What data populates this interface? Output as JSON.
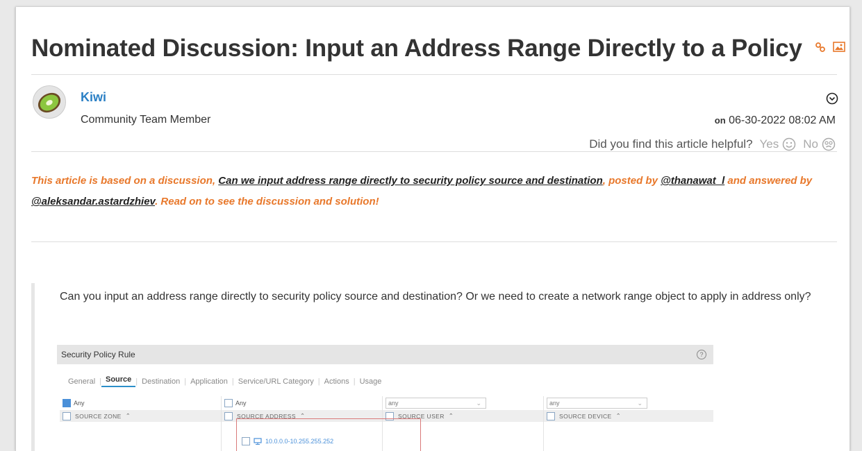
{
  "article": {
    "title": "Nominated Discussion: Input an Address Range Directly to a Policy",
    "title_icons": [
      "link-icon",
      "image-icon"
    ]
  },
  "author": {
    "name": "Kiwi",
    "role": "Community Team Member",
    "avatar": "kiwi-avatar"
  },
  "meta": {
    "date_prefix": "on",
    "date": "06-30-2022 08:02 AM",
    "helpful_question": "Did you find this article helpful?",
    "yes_label": "Yes",
    "no_label": "No"
  },
  "intro": {
    "part1": "This article is based on a discussion, ",
    "discussion_link": "Can we input address range directly to security policy source and destination",
    "part2": ", posted by ",
    "poster_link": "@thanawat_l",
    "part3": " and answered by ",
    "answerer_link": "@aleksandar.astardzhiev",
    "part4": ". Read on to see the discussion and solution!"
  },
  "question": {
    "text": "Can you input an address range directly to security policy source and destination? Or we need to create a network range object to apply in address only?"
  },
  "screenshot": {
    "title": "Security Policy Rule",
    "help": "?",
    "tabs": [
      "General",
      "Source",
      "Destination",
      "Application",
      "Service/URL Category",
      "Actions",
      "Usage"
    ],
    "active_tab": "Source",
    "col1_any": "Any",
    "col2_any": "Any",
    "col3_any": "any",
    "col4_any": "any",
    "col1_head": "SOURCE ZONE",
    "col2_head": "SOURCE ADDRESS",
    "col3_head": "SOURCE USER",
    "col4_head": "SOURCE DEVICE",
    "address_value": "10.0.0.0-10.255.255.252"
  },
  "colors": {
    "accent_orange": "#e8782b",
    "link_blue": "#2b80c5",
    "title_text": "#333333"
  }
}
